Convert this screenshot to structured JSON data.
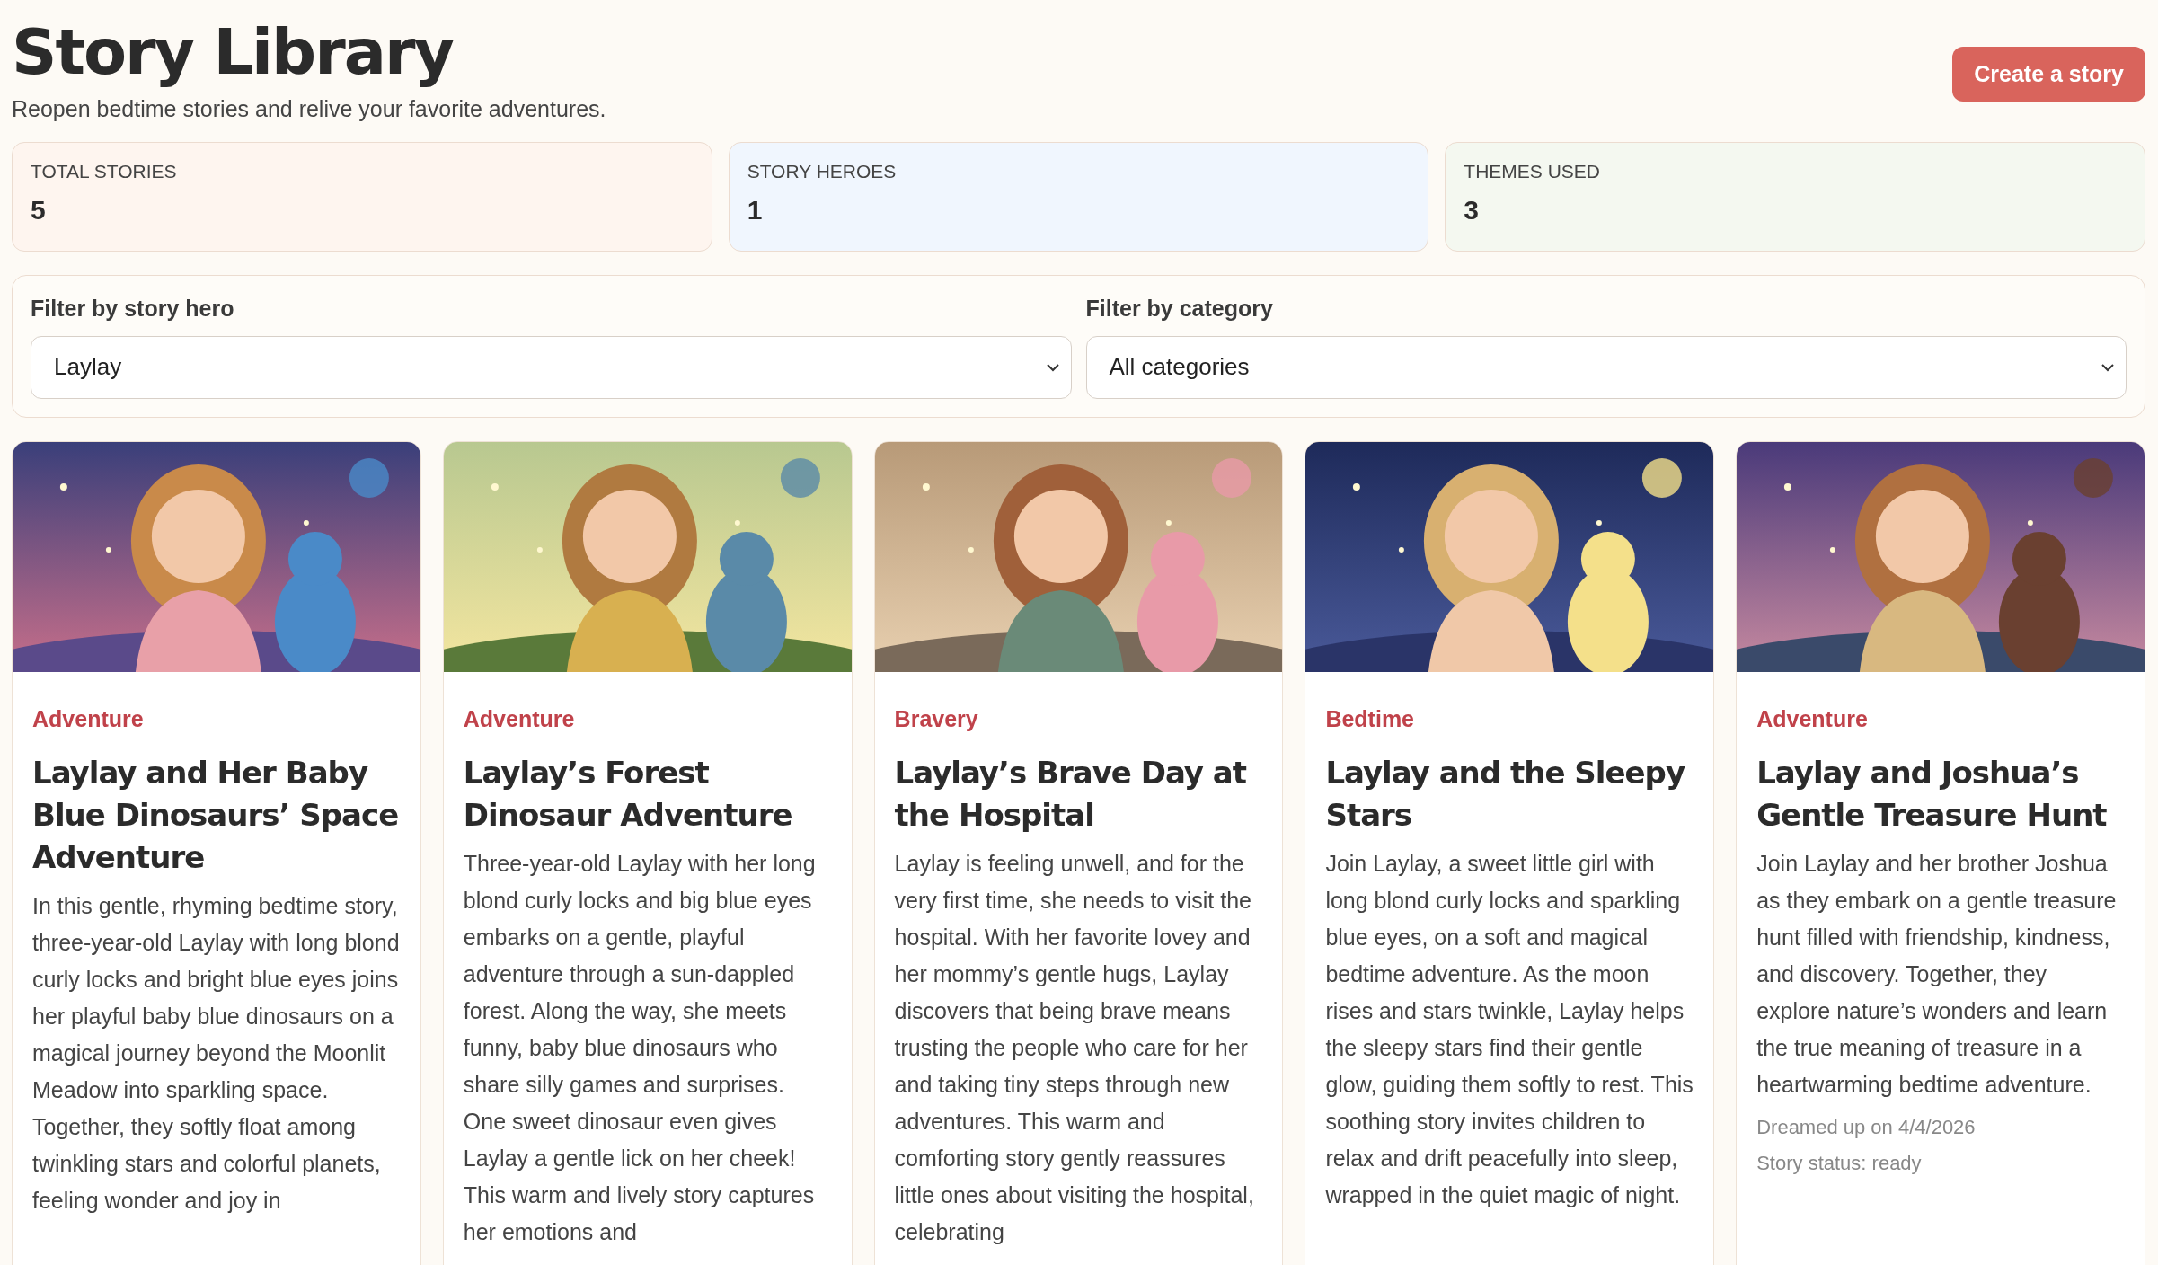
{
  "header": {
    "title": "Story Library",
    "subtitle": "Reopen bedtime stories and relive your favorite adventures.",
    "action": "Create a story"
  },
  "stats": [
    {
      "label": "TOTAL STORIES",
      "value": "5",
      "color": "#fef5ef"
    },
    {
      "label": "STORY HEROES",
      "value": "1",
      "color": "#f0f6fe"
    },
    {
      "label": "THEMES USED",
      "value": "3",
      "color": "#f4f8f0"
    }
  ],
  "filters": [
    {
      "label": "Filter by story hero",
      "value": "Laylay"
    },
    {
      "label": "Filter by category",
      "value": "All categories"
    }
  ],
  "stories": [
    {
      "category": "Adventure",
      "title": "Laylay and Her Baby Blue Dinosaurs’ Space Adventure",
      "description": "In this gentle, rhyming bedtime story, three-year-old Laylay with long blond curly locks and bright blue eyes joins her playful baby blue dinosaurs on a magical journey beyond the Moonlit Meadow into sparkling space. Together, they softly float among twinkling stars and colorful planets, feeling wonder and joy in"
    },
    {
      "category": "Adventure",
      "title": "Laylay’s Forest Dinosaur Adventure",
      "description": "Three-year-old Laylay with her long blond curly locks and big blue eyes embarks on a gentle, playful adventure through a sun-dappled forest. Along the way, she meets funny, baby blue dinosaurs who share silly games and surprises. One sweet dinosaur even gives Laylay a gentle lick on her cheek! This warm and lively story captures her emotions and"
    },
    {
      "category": "Bravery",
      "title": "Laylay’s Brave Day at the Hospital",
      "description": "Laylay is feeling unwell, and for the very first time, she needs to visit the hospital. With her favorite lovey and her mommy’s gentle hugs, Laylay discovers that being brave means trusting the people who care for her and taking tiny steps through new adventures. This warm and comforting story gently reassures little ones about visiting the hospital, celebrating"
    },
    {
      "category": "Bedtime",
      "title": "Laylay and the Sleepy Stars",
      "description": "Join Laylay, a sweet little girl with long blond curly locks and sparkling blue eyes, on a soft and magical bedtime adventure. As the moon rises and stars twinkle, Laylay helps the sleepy stars find their gentle glow, guiding them softly to rest. This soothing story invites children to relax and drift peacefully into sleep, wrapped in the quiet magic of night."
    },
    {
      "category": "Adventure",
      "title": "Laylay and Joshua’s Gentle Treasure Hunt",
      "description": "Join Laylay and her brother Joshua as they embark on a gentle treasure hunt filled with friendship, kindness, and discovery. Together, they explore nature’s wonders and learn the true meaning of treasure in a heartwarming bedtime adventure.",
      "date": "Dreamed up on 4/4/2026",
      "status": "Story status: ready"
    }
  ]
}
